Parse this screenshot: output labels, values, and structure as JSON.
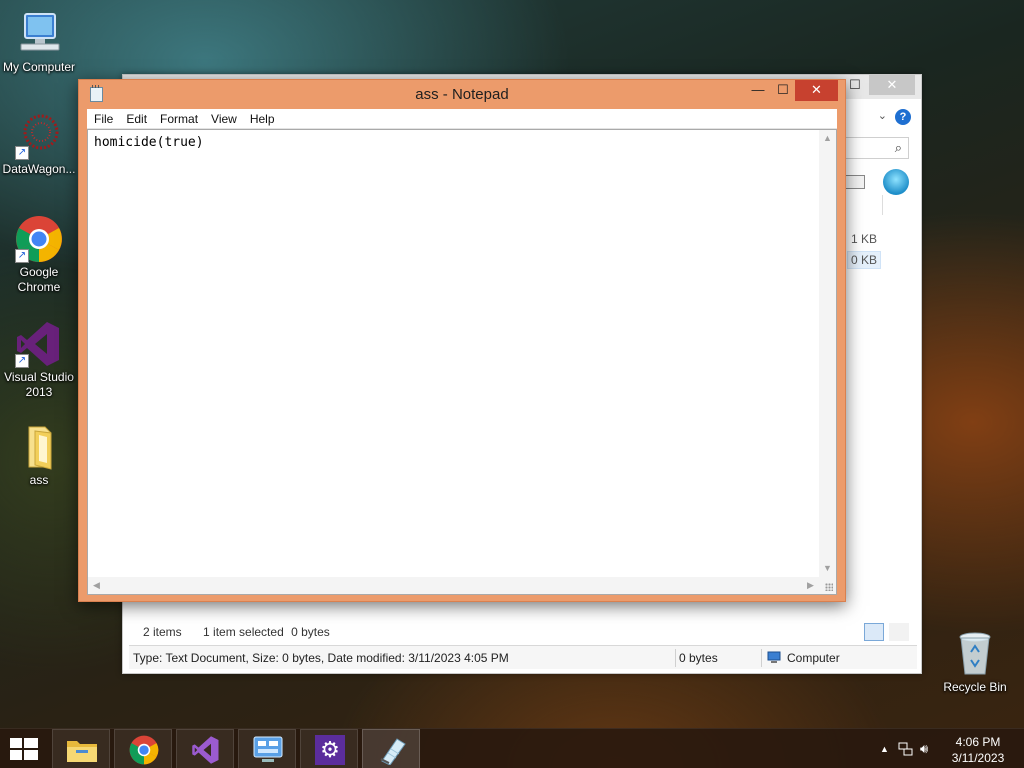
{
  "desktop": {
    "icons": [
      {
        "label": "My Computer"
      },
      {
        "label": "DataWagon..."
      },
      {
        "label": "Google Chrome"
      },
      {
        "label": "Visual Studio 2013"
      },
      {
        "label": "ass"
      },
      {
        "label": "Recycle Bin"
      }
    ]
  },
  "notepad": {
    "title": "ass - Notepad",
    "controls": {
      "minimize": "—",
      "maximize": "☐",
      "close": "✕"
    },
    "menu": [
      "File",
      "Edit",
      "Format",
      "View",
      "Help"
    ],
    "content": "homicide(true)"
  },
  "explorer": {
    "close": "✕",
    "maximize": "☐",
    "help": "?",
    "file_sizes": [
      "1 KB",
      "0 KB"
    ],
    "status": {
      "items": "2 items",
      "selected": "1 item selected",
      "size": "0 bytes"
    },
    "details": {
      "text": "Type: Text Document, Size: 0 bytes, Date modified: 3/11/2023 4:05 PM",
      "size": "0 bytes",
      "location": "Computer"
    }
  },
  "taskbar": {
    "time": "4:06 PM",
    "date": "3/11/2023"
  }
}
